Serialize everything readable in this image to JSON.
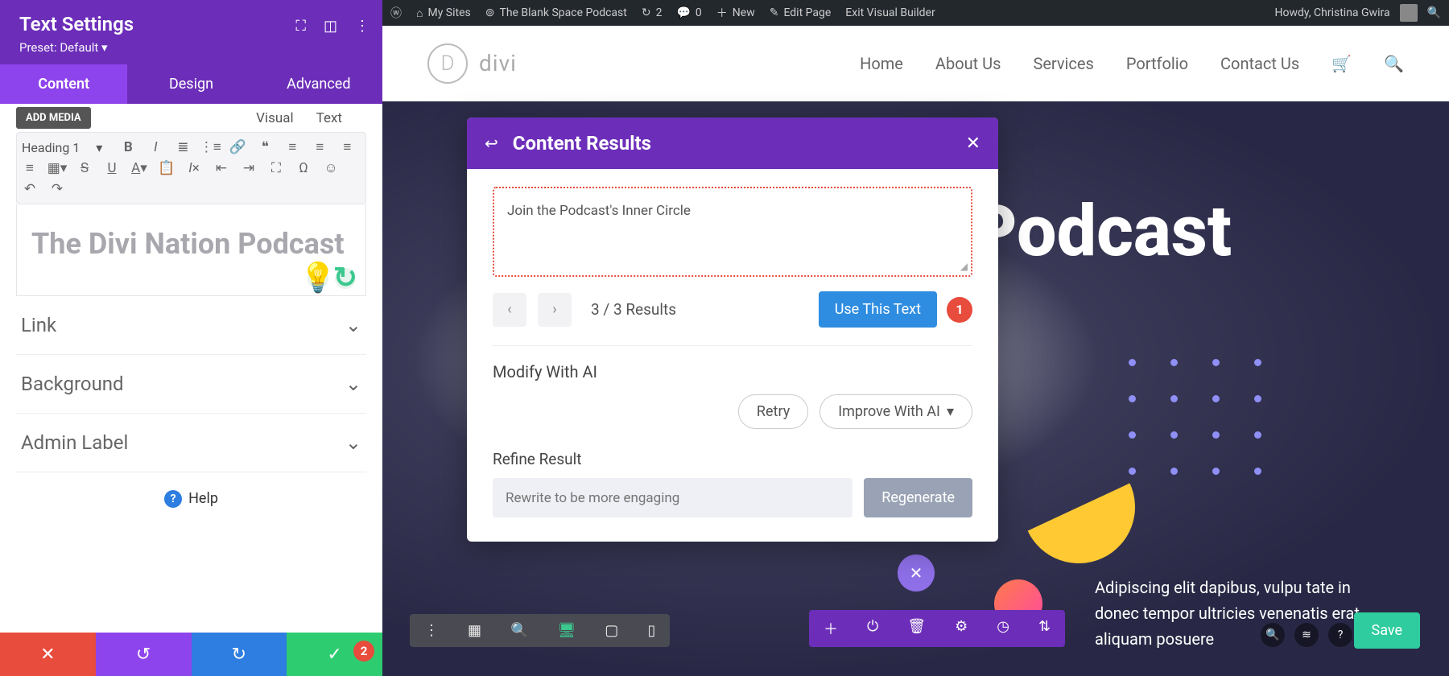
{
  "admin_bar": {
    "my_sites": "My Sites",
    "site_name": "The Blank Space Podcast",
    "updates_count": "2",
    "comments_count": "0",
    "new_label": "New",
    "edit_page": "Edit Page",
    "exit_vb": "Exit Visual Builder",
    "howdy": "Howdy, Christina Gwira"
  },
  "sidebar": {
    "title": "Text Settings",
    "preset": "Preset: Default ▾",
    "tabs": {
      "content": "Content",
      "design": "Design",
      "advanced": "Advanced"
    },
    "add_media": "ADD MEDIA",
    "visual": "Visual",
    "text_tab": "Text",
    "heading_selector": "Heading 1",
    "editor_content": "The Divi Nation Podcast",
    "acc_link": "Link",
    "acc_background": "Background",
    "acc_admin": "Admin Label",
    "help": "Help",
    "footer_badge": "2"
  },
  "site": {
    "logo_text": "divi",
    "nav": {
      "home": "Home",
      "about": "About Us",
      "services": "Services",
      "portfolio": "Portfolio",
      "contact": "Contact Us"
    }
  },
  "hero": {
    "title": "Podcast",
    "para": "Adipiscing elit dapibus, vulpu tate in donec tempor ultricies venenatis erat, aliquam posuere"
  },
  "modal": {
    "title": "Content Results",
    "result_text": "Join the Podcast's Inner Circle",
    "count": "3 / 3 Results",
    "use_text": "Use This Text",
    "callout": "1",
    "modify_title": "Modify With AI",
    "retry": "Retry",
    "improve": "Improve With AI",
    "refine_title": "Refine Result",
    "refine_placeholder": "Rewrite to be more engaging",
    "regenerate": "Regenerate"
  },
  "bottom": {
    "save": "Save"
  }
}
